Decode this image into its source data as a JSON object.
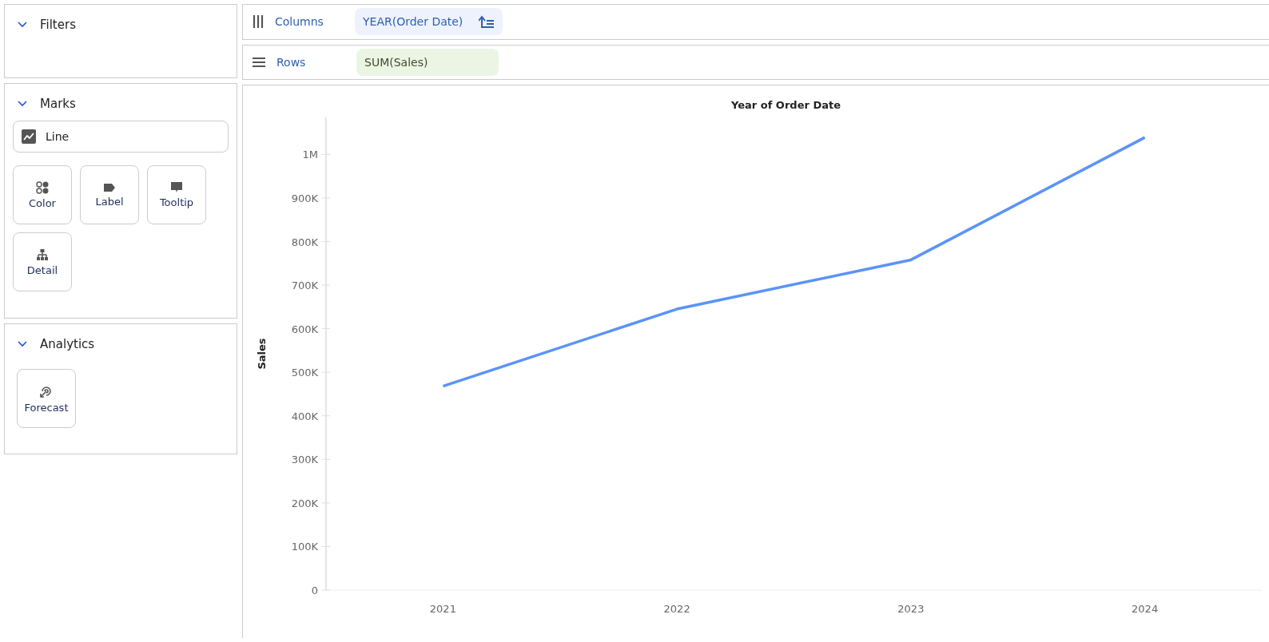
{
  "sidebar": {
    "sections": [
      {
        "title": "Filters",
        "expanded": true
      },
      {
        "title": "Marks",
        "expanded": true,
        "mark_type": "Line",
        "buttons": [
          {
            "label": "Color",
            "kind": "color"
          },
          {
            "label": "Label",
            "kind": "label"
          },
          {
            "label": "Tooltip",
            "kind": "tooltip"
          },
          {
            "label": "Detail",
            "kind": "detail"
          }
        ]
      },
      {
        "title": "Analytics",
        "expanded": true,
        "buttons": [
          {
            "label": "Forecast",
            "kind": "forecast"
          }
        ]
      }
    ]
  },
  "shelves": [
    {
      "label": "Columns",
      "kind": "columns",
      "pill": {
        "text": "YEAR(Order Date)",
        "kind": "dimension",
        "sorted": true
      }
    },
    {
      "label": "Rows",
      "kind": "rows",
      "pill": {
        "text": "SUM(Sales)",
        "kind": "measure",
        "sorted": false
      }
    }
  ],
  "view": {
    "chart_data": {
      "type": "line",
      "title": "Year of Order Date",
      "ylabel": "Sales",
      "categories": [
        "2021",
        "2022",
        "2023",
        "2024"
      ],
      "series": [
        {
          "color": "#5b93f8",
          "values": [
            468000,
            645000,
            758000,
            1039000
          ]
        }
      ],
      "ylim": [
        0,
        1085000
      ],
      "yticks": [
        {
          "value": 0,
          "label": "0"
        },
        {
          "value": 100000,
          "label": "100K"
        },
        {
          "value": 200000,
          "label": "200K"
        },
        {
          "value": 300000,
          "label": "300K"
        },
        {
          "value": 400000,
          "label": "400K"
        },
        {
          "value": 500000,
          "label": "500K"
        },
        {
          "value": 600000,
          "label": "600K"
        },
        {
          "value": 700000,
          "label": "700K"
        },
        {
          "value": 800000,
          "label": "800K"
        },
        {
          "value": 900000,
          "label": "900K"
        },
        {
          "value": 1000000,
          "label": "1M"
        }
      ]
    }
  }
}
